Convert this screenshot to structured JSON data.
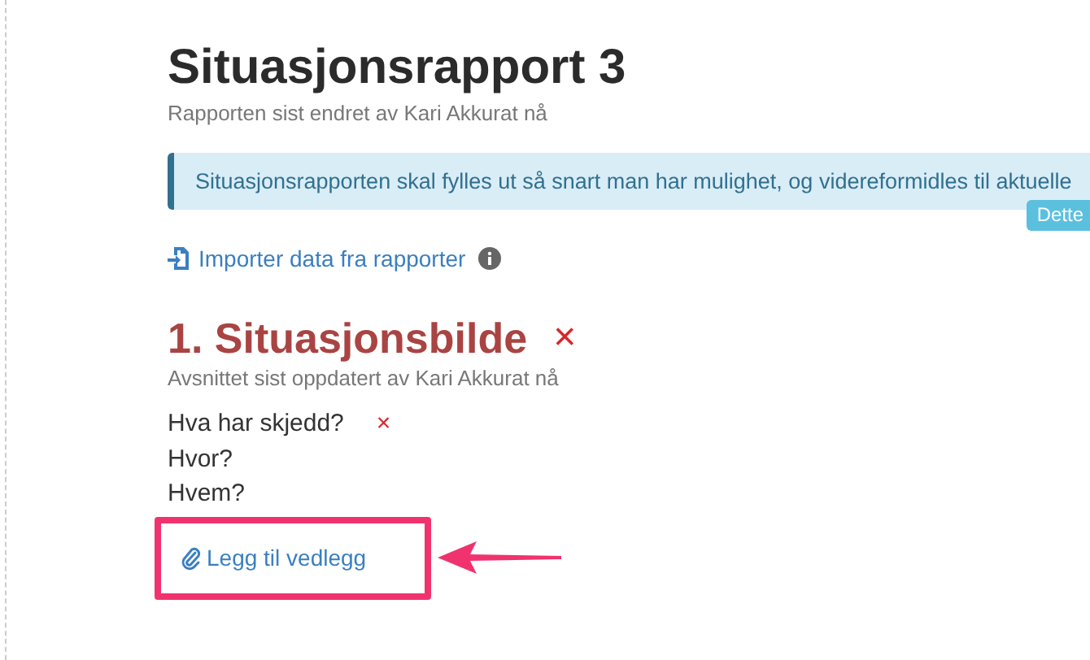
{
  "report": {
    "title": "Situasjonsrapport 3",
    "subtitle": "Rapporten sist endret av Kari Akkurat nå"
  },
  "alert": {
    "text": "Situasjonsrapporten skal fylles ut så snart man har mulighet, og videreformidles til aktuelle",
    "tooltip": "Dette"
  },
  "import_link": {
    "label": "Importer data fra rapporter"
  },
  "section": {
    "title": "1. Situasjonsbilde",
    "remove": "×",
    "subtitle": "Avsnittet sist oppdatert av Kari Akkurat nå",
    "questions": [
      {
        "label": "Hva har skjedd?",
        "remove": "×"
      },
      {
        "label": "Hvor?"
      },
      {
        "label": "Hvem?"
      }
    ],
    "attach_link": {
      "label": "Legg til vedlegg"
    }
  }
}
